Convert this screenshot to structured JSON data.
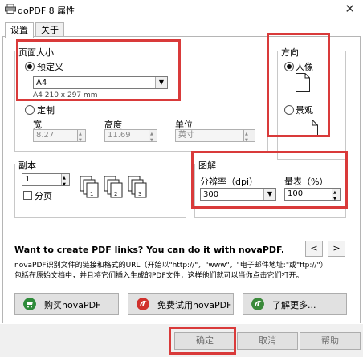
{
  "window": {
    "title": "doPDF 8 属性",
    "close_label": "✕"
  },
  "tabs": [
    {
      "label": "设置",
      "active": true
    },
    {
      "label": "关于",
      "active": false
    }
  ],
  "page_size": {
    "group_title": "页面大小",
    "predefined_label": "预定义",
    "predefined_selected": true,
    "paper_value": "A4",
    "paper_desc": "A4 210 x 297 mm",
    "custom_label": "定制",
    "width_label": "宽",
    "width_value": "8.27",
    "height_label": "高度",
    "height_value": "11.69",
    "unit_label": "单位",
    "unit_value": "英寸"
  },
  "orientation": {
    "group_title": "方向",
    "portrait_label": "人像",
    "portrait_selected": true,
    "landscape_label": "景观"
  },
  "copies": {
    "group_title": "副本",
    "count_value": "1",
    "collate_label": "分页",
    "collate_checked": false
  },
  "resolution": {
    "group_title": "图解",
    "dpi_label": "分辨率（dpi）",
    "dpi_value": "300",
    "scale_label": "量表（%）",
    "scale_value": "100"
  },
  "promo": {
    "headline": "Want to create PDF links? You can do it with novaPDF.",
    "line1": "novaPDF识别文件的链接和格式的URL（开始以\"http://\"，\"www\"，\"电子邮件地址:\"或\"ftp://\"）",
    "line2": "包括在原始文档中，并且将它们插入生成的PDF文件，这样他们就可以当你点击它们打开。",
    "prev_label": "<",
    "next_label": ">",
    "buy_label": "购买novaPDF",
    "trial_label": "免费试用novaPDF",
    "more_label": "了解更多..."
  },
  "footer": {
    "ok_label": "确定",
    "cancel_label": "取消",
    "help_label": "帮助"
  },
  "colors": {
    "highlight": "#d93a3a",
    "buy_icon": "#2e8b3a",
    "trial_icon": "#d0312d",
    "more_icon": "#3a8a3a"
  }
}
